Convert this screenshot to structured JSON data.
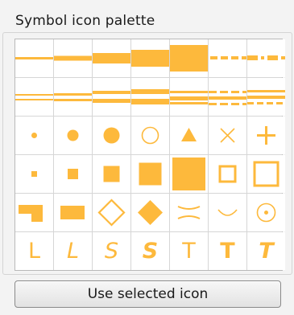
{
  "palette": {
    "title": "Symbol icon palette",
    "accent_color": "#FDB93C",
    "icons": [
      "line-thin-icon",
      "line-medium-icon",
      "line-thick-icon",
      "line-heavy-icon",
      "line-block-icon",
      "line-dashed-icon",
      "line-dash-dot-icon",
      "double-line-thin-icon",
      "double-line-medium-icon",
      "double-line-heavy-icon",
      "double-line-bold-icon",
      "double-line-wide-icon",
      "triple-dashed-line-icon",
      "triple-dash-line-icon",
      "dot-small-icon",
      "dot-medium-icon",
      "dot-large-icon",
      "circle-outline-icon",
      "triangle-icon",
      "cross-x-icon",
      "plus-icon",
      "square-tiny-icon",
      "square-small-icon",
      "square-medium-icon",
      "square-large-icon",
      "square-xlarge-icon",
      "square-outline-icon",
      "square-outline-large-icon",
      "step-shape-icon",
      "rectangle-icon",
      "diamond-outline-icon",
      "diamond-filled-icon",
      "pinch-lines-icon",
      "arc-curve-icon",
      "bullseye-icon",
      "letter-l-icon",
      "letter-italic-l-icon",
      "letter-s-icon",
      "letter-italic-s-icon",
      "letter-t-icon",
      "letter-bold-t-icon",
      "letter-italic-t-icon"
    ]
  },
  "actions": {
    "use_selected_label": "Use selected icon"
  }
}
